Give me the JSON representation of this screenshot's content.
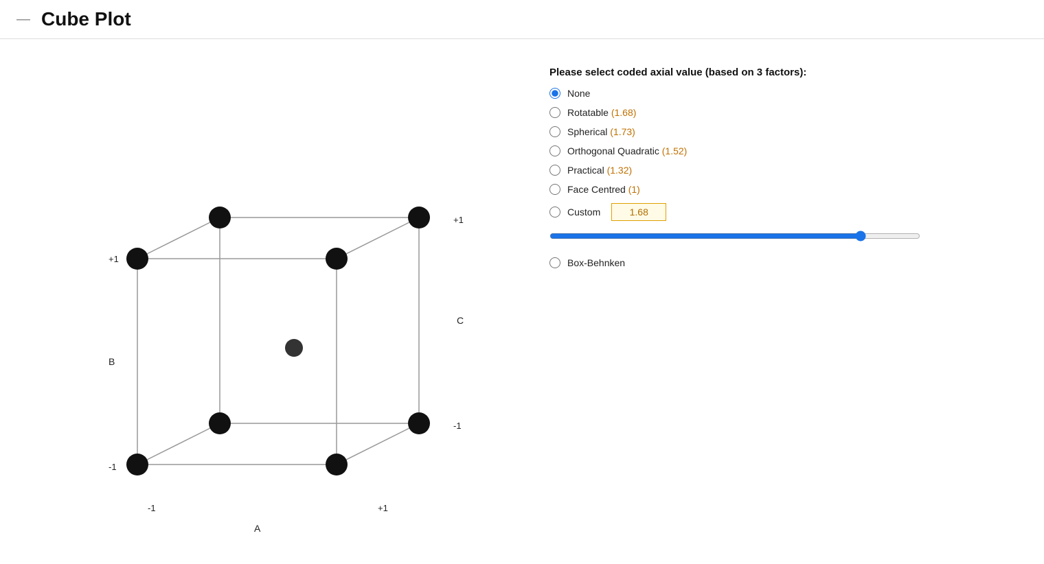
{
  "header": {
    "dash": "—",
    "title": "Cube Plot"
  },
  "panel": {
    "title": "Please select coded axial value (based on 3 factors):",
    "options": [
      {
        "id": "none",
        "label": "None",
        "value": "none",
        "extra": "",
        "checked": true
      },
      {
        "id": "rotatable",
        "label": "Rotatable (1.68)",
        "value": "rotatable",
        "extra": "1.68",
        "checked": false
      },
      {
        "id": "spherical",
        "label": "Spherical (1.73)",
        "value": "spherical",
        "extra": "1.73",
        "checked": false
      },
      {
        "id": "ortho_quad",
        "label": "Orthogonal Quadratic (1.52)",
        "value": "ortho_quad",
        "extra": "1.52",
        "checked": false
      },
      {
        "id": "practical",
        "label": "Practical (1.32)",
        "value": "practical",
        "extra": "1.32",
        "checked": false
      },
      {
        "id": "face_centred",
        "label": "Face Centred (1)",
        "value": "face_centred",
        "extra": "1",
        "checked": false
      },
      {
        "id": "custom",
        "label": "Custom",
        "value": "custom",
        "extra": "",
        "checked": false
      },
      {
        "id": "box_behnken",
        "label": "Box-Behnken",
        "value": "box_behnken",
        "extra": "",
        "checked": false
      }
    ],
    "custom_value": "1.68",
    "slider_value": 85,
    "slider_min": 0,
    "slider_max": 100
  },
  "cube": {
    "axis_labels": {
      "a_label": "A",
      "b_label": "B",
      "c_label": "C"
    },
    "a_neg": "-1",
    "a_pos": "+1",
    "b_neg": "-1",
    "b_pos": "+1",
    "c_neg": "-1",
    "c_pos": "+1"
  }
}
